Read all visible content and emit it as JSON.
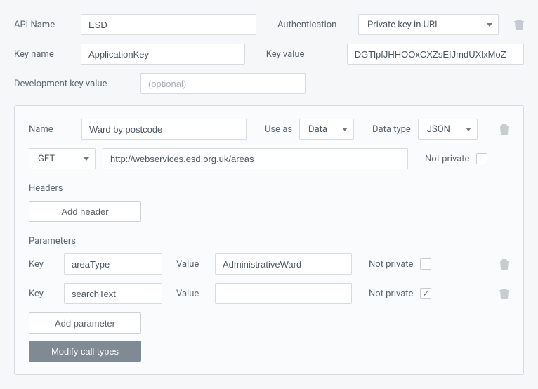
{
  "api": {
    "name_label": "API Name",
    "name_value": "ESD",
    "auth_label": "Authentication",
    "auth_value": "Private key in URL",
    "key_name_label": "Key name",
    "key_name_value": "ApplicationKey",
    "key_value_label": "Key value",
    "key_value_value": "DGTlpfJHHOOxCXZsEIJmdUXlxMoZ",
    "dev_key_label": "Development key value",
    "dev_key_placeholder": "(optional)"
  },
  "call": {
    "name_label": "Name",
    "name_value": "Ward by postcode",
    "use_as_label": "Use as",
    "use_as_value": "Data",
    "data_type_label": "Data type",
    "data_type_value": "JSON",
    "method": "GET",
    "url": "http://webservices.esd.org.uk/areas",
    "not_private_label": "Not private",
    "not_private": false
  },
  "headers": {
    "title": "Headers",
    "add_label": "Add header"
  },
  "parameters": {
    "title": "Parameters",
    "key_label": "Key",
    "value_label": "Value",
    "not_private_label": "Not private",
    "rows": [
      {
        "key": "areaType",
        "value": "AdministrativeWard",
        "not_private": false
      },
      {
        "key": "searchText",
        "value": "",
        "not_private": true
      }
    ],
    "add_label": "Add parameter"
  },
  "buttons": {
    "modify_call_types": "Modify call types"
  }
}
